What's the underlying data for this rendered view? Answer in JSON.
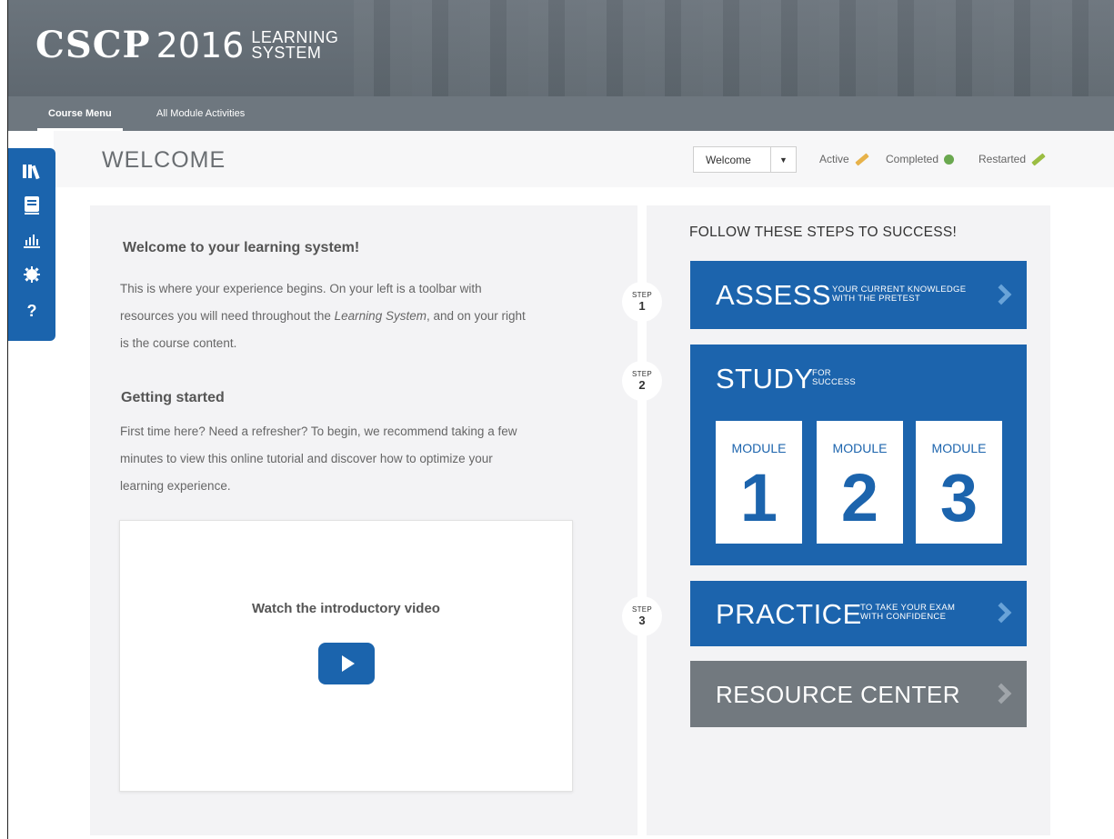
{
  "header": {
    "brand": "CSCP",
    "year": "2016",
    "system_line1": "LEARNING",
    "system_line2": "SYSTEM"
  },
  "nav": {
    "tabs": [
      {
        "label": "Course Menu",
        "active": true
      },
      {
        "label": "All Module Activities",
        "active": false
      }
    ]
  },
  "page": {
    "title": "WELCOME",
    "select_value": "Welcome",
    "legend": [
      {
        "label": "Active",
        "icon": "pencil-icon",
        "color": "#e7b24a"
      },
      {
        "label": "Completed",
        "icon": "check-circle-icon",
        "color": "#6aa84f"
      },
      {
        "label": "Restarted",
        "icon": "pencil-icon",
        "color": "#9bbd43"
      }
    ]
  },
  "toolbar": {
    "icons": [
      "library-icon",
      "book-icon",
      "chart-icon",
      "gear-icon",
      "help-icon"
    ]
  },
  "intro": {
    "heading": "Welcome to your learning system!",
    "text_part1": "This is where your experience begins. On your left is a toolbar with resources you will need throughout the ",
    "text_italic": "Learning System",
    "text_part2": ", and on your right is the course content.",
    "start_heading": "Getting started",
    "start_text": "First time here? Need a refresher? To begin, we recommend taking a few minutes to view this online tutorial and discover how to optimize your learning experience.",
    "video_title": "Watch the introductory video"
  },
  "steps": {
    "title": "FOLLOW THESE STEPS TO SUCCESS!",
    "step_label": "STEP",
    "assess": {
      "num": "1",
      "big": "ASSESS",
      "small1": "YOUR CURRENT KNOWLEDGE",
      "small2": "WITH THE PRETEST"
    },
    "study": {
      "num": "2",
      "big": "STUDY",
      "small1": "FOR",
      "small2": "SUCCESS",
      "modules": [
        {
          "label": "MODULE",
          "number": "1"
        },
        {
          "label": "MODULE",
          "number": "2"
        },
        {
          "label": "MODULE",
          "number": "3"
        }
      ]
    },
    "practice": {
      "num": "3",
      "big": "PRACTICE",
      "small1": "TO TAKE YOUR EXAM",
      "small2": "WITH CONFIDENCE"
    },
    "resource": {
      "big": "RESOURCE CENTER"
    }
  },
  "colors": {
    "primary_blue": "#1c64ad",
    "header_gray": "#6b747c",
    "resource_gray": "#72797f"
  }
}
